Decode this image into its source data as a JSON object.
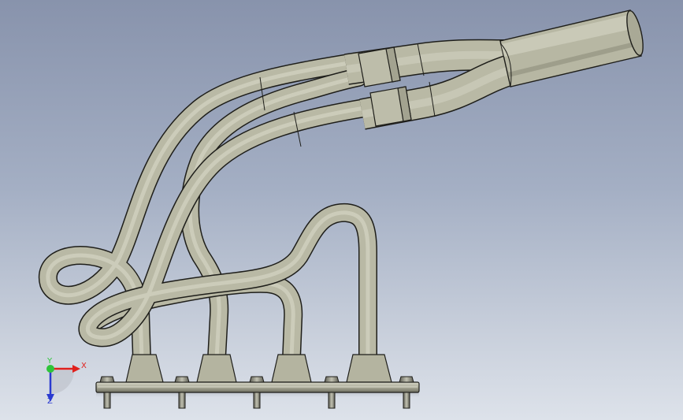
{
  "viewport": {
    "background_top": "#8893ac",
    "background_bottom": "#dde2ea"
  },
  "model": {
    "surface_color": "#b9b9a5",
    "edge_color": "#1e1e1a"
  },
  "triad": {
    "x_label": "X",
    "y_label": "Y",
    "z_label": "Z",
    "x_color": "#e0201c",
    "y_color": "#2ec43a",
    "z_color": "#2a3ad0"
  }
}
